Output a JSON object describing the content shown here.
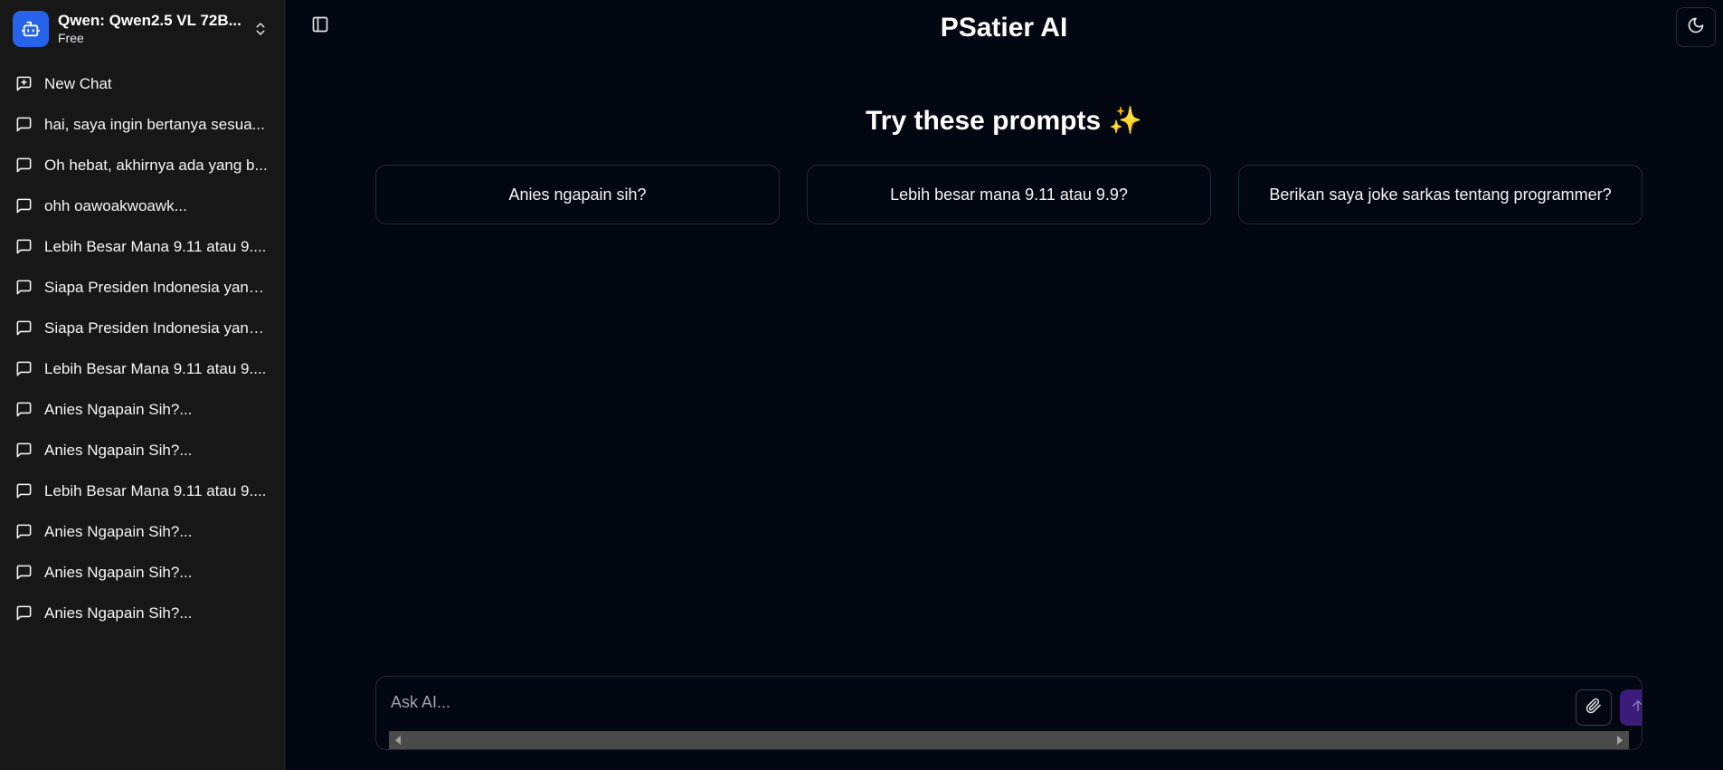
{
  "model": {
    "name": "Qwen: Qwen2.5 VL 72B...",
    "tier": "Free"
  },
  "sidebar": {
    "new_chat_label": "New Chat",
    "history": [
      {
        "label": "hai, saya ingin bertanya sesua..."
      },
      {
        "label": "Oh hebat, akhirnya ada yang b..."
      },
      {
        "label": "ohh oawoakwoawk..."
      },
      {
        "label": "Lebih Besar Mana 9.11 atau 9...."
      },
      {
        "label": "Siapa Presiden Indonesia yang..."
      },
      {
        "label": "Siapa Presiden Indonesia yang..."
      },
      {
        "label": "Lebih Besar Mana 9.11 atau 9...."
      },
      {
        "label": "Anies Ngapain Sih?..."
      },
      {
        "label": "Anies Ngapain Sih?..."
      },
      {
        "label": "Lebih Besar Mana 9.11 atau 9...."
      },
      {
        "label": "Anies Ngapain Sih?..."
      },
      {
        "label": "Anies Ngapain Sih?..."
      },
      {
        "label": "Anies Ngapain Sih?..."
      }
    ]
  },
  "header": {
    "title": "PSatier AI"
  },
  "main": {
    "prompts_heading": "Try these prompts ✨",
    "prompts": [
      {
        "label": "Anies ngapain sih?"
      },
      {
        "label": "Lebih besar mana 9.11 atau 9.9?"
      },
      {
        "label": "Berikan saya joke sarkas tentang programmer?"
      }
    ]
  },
  "composer": {
    "placeholder": "Ask AI...",
    "value": ""
  },
  "icons": {
    "model_logo": "bot-icon",
    "model_switch": "chevrons-up-down-icon",
    "new_chat": "message-square-plus-icon",
    "history_item": "message-square-icon",
    "sidebar_toggle": "panel-left-icon",
    "theme_toggle": "moon-icon",
    "attach": "paperclip-icon",
    "send": "arrow-up-icon"
  },
  "colors": {
    "background": "#030712",
    "sidebar": "#171717",
    "accent_logo": "#2563eb",
    "send_button": "#3b1c7a",
    "card_border": "#1f2937"
  }
}
